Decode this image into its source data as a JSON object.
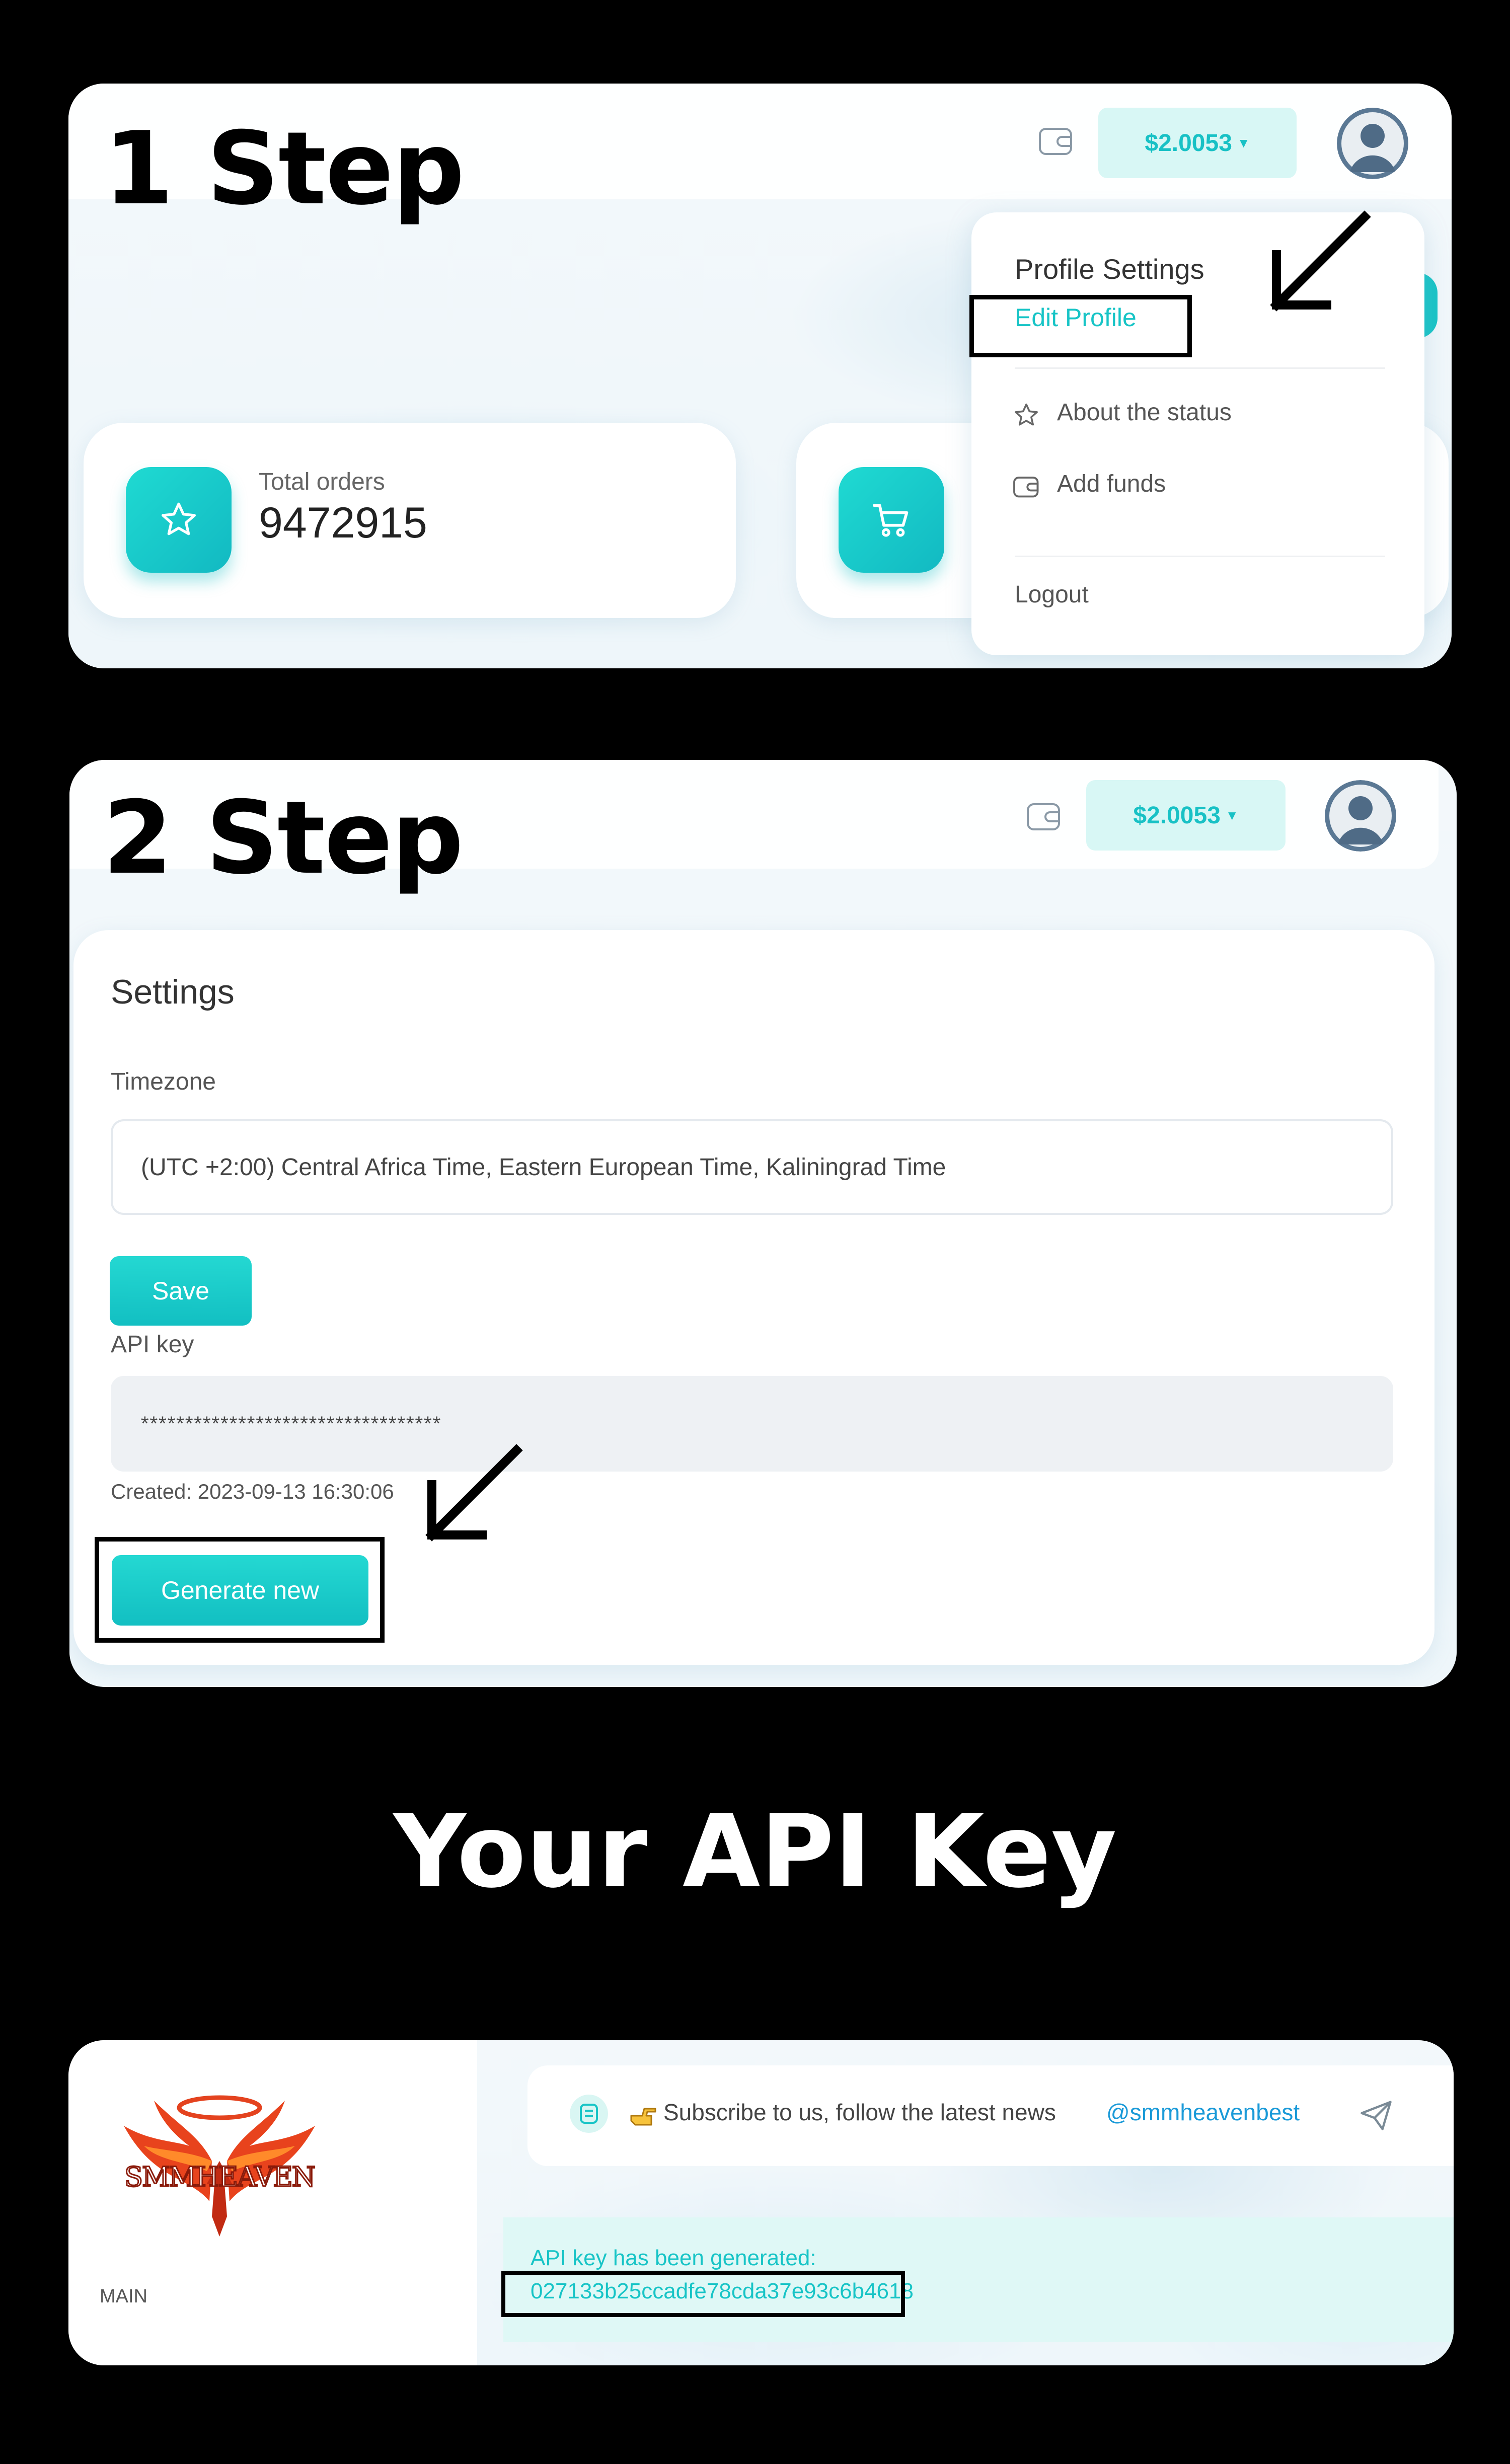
{
  "step1": {
    "title": "1 Step",
    "balance": "$2.0053",
    "dropdown": {
      "header": "Profile Settings",
      "edit_profile": "Edit Profile",
      "about_status": "About the status",
      "add_funds": "Add funds",
      "logout": "Logout"
    },
    "total_orders_label": "Total orders",
    "total_orders_value": "9472915"
  },
  "step2": {
    "title": "2 Step",
    "balance": "$2.0053",
    "settings_title": "Settings",
    "timezone_label": "Timezone",
    "timezone_value": "(UTC +2:00) Central Africa Time, Eastern European Time, Kaliningrad Time",
    "save_label": "Save",
    "api_key_label": "API key",
    "api_key_masked": "**********************************",
    "created_text": "Created: 2023-09-13 16:30:06",
    "generate_label": "Generate new"
  },
  "heading": "Your API Key",
  "step3": {
    "logo_text": "SMMHEAVEN",
    "main_label": "MAIN",
    "news_text": "Subscribe to us, follow the latest news",
    "news_handle": "@smmheavenbest",
    "alert_title": "API key has been generated:",
    "alert_key": "027133b25ccadfe78cda37e93c6b4618"
  },
  "colors": {
    "accent": "#17c4c6",
    "background": "#000000",
    "panel": "#ffffff"
  }
}
